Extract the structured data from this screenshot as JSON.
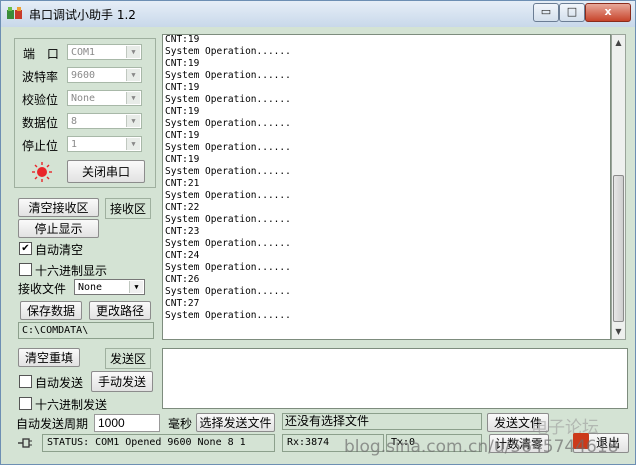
{
  "window": {
    "title": "串口调试小助手 1.2",
    "controls": {
      "minimize": "▭",
      "maximize": "□",
      "close": "x"
    }
  },
  "settings": {
    "port_label": "端 口",
    "port_value": "COM1",
    "baud_label": "波特率",
    "baud_value": "9600",
    "parity_label": "校验位",
    "parity_value": "None",
    "databits_label": "数据位",
    "databits_value": "8",
    "stopbits_label": "停止位",
    "stopbits_value": "1",
    "close_port_button": "关闭串口",
    "status_lamp_color": "#e8262a"
  },
  "receive": {
    "clear_button": "清空接收区",
    "area_label": "接收区",
    "stop_display_button": "停止显示",
    "auto_clear_label": "自动清空",
    "auto_clear_checked": "✔",
    "hex_display_label": "十六进制显示",
    "receive_file_label": "接收文件",
    "receive_file_value": "None",
    "save_data_button": "保存数据",
    "change_path_button": "更改路径",
    "path_value": "C:\\COMDATA\\",
    "output_lines": [
      "CNT:19",
      "System Operation......",
      "CNT:19",
      "System Operation......",
      "CNT:19",
      "System Operation......",
      "CNT:19",
      "System Operation......",
      "CNT:19",
      "System Operation......",
      "CNT:19",
      "System Operation......",
      "CNT:21",
      "System Operation......",
      "CNT:22",
      "System Operation......",
      "CNT:23",
      "System Operation......",
      "CNT:24",
      "System Operation......",
      "CNT:26",
      "System Operation......",
      "CNT:27",
      "System Operation......"
    ]
  },
  "send": {
    "clear_button": "清空重填",
    "area_label": "发送区",
    "auto_send_label": "自动发送",
    "manual_send_button": "手动发送",
    "hex_send_label": "十六进制发送",
    "period_label": "自动发送周期",
    "period_value": "1000",
    "period_unit": "毫秒",
    "select_file_button": "选择发送文件",
    "file_status": "还没有选择文件",
    "send_file_button": "发送文件",
    "count_clear_button": "计数清零",
    "exit_button": "退出"
  },
  "statusbar": {
    "status": "STATUS: COM1 Opened 9600 None 8 1",
    "rx": "Rx:3874",
    "tx": "Tx:0"
  },
  "watermark": {
    "forum": "电子论坛",
    "blog": "blog.sina.com.cn/u/5645744618"
  }
}
